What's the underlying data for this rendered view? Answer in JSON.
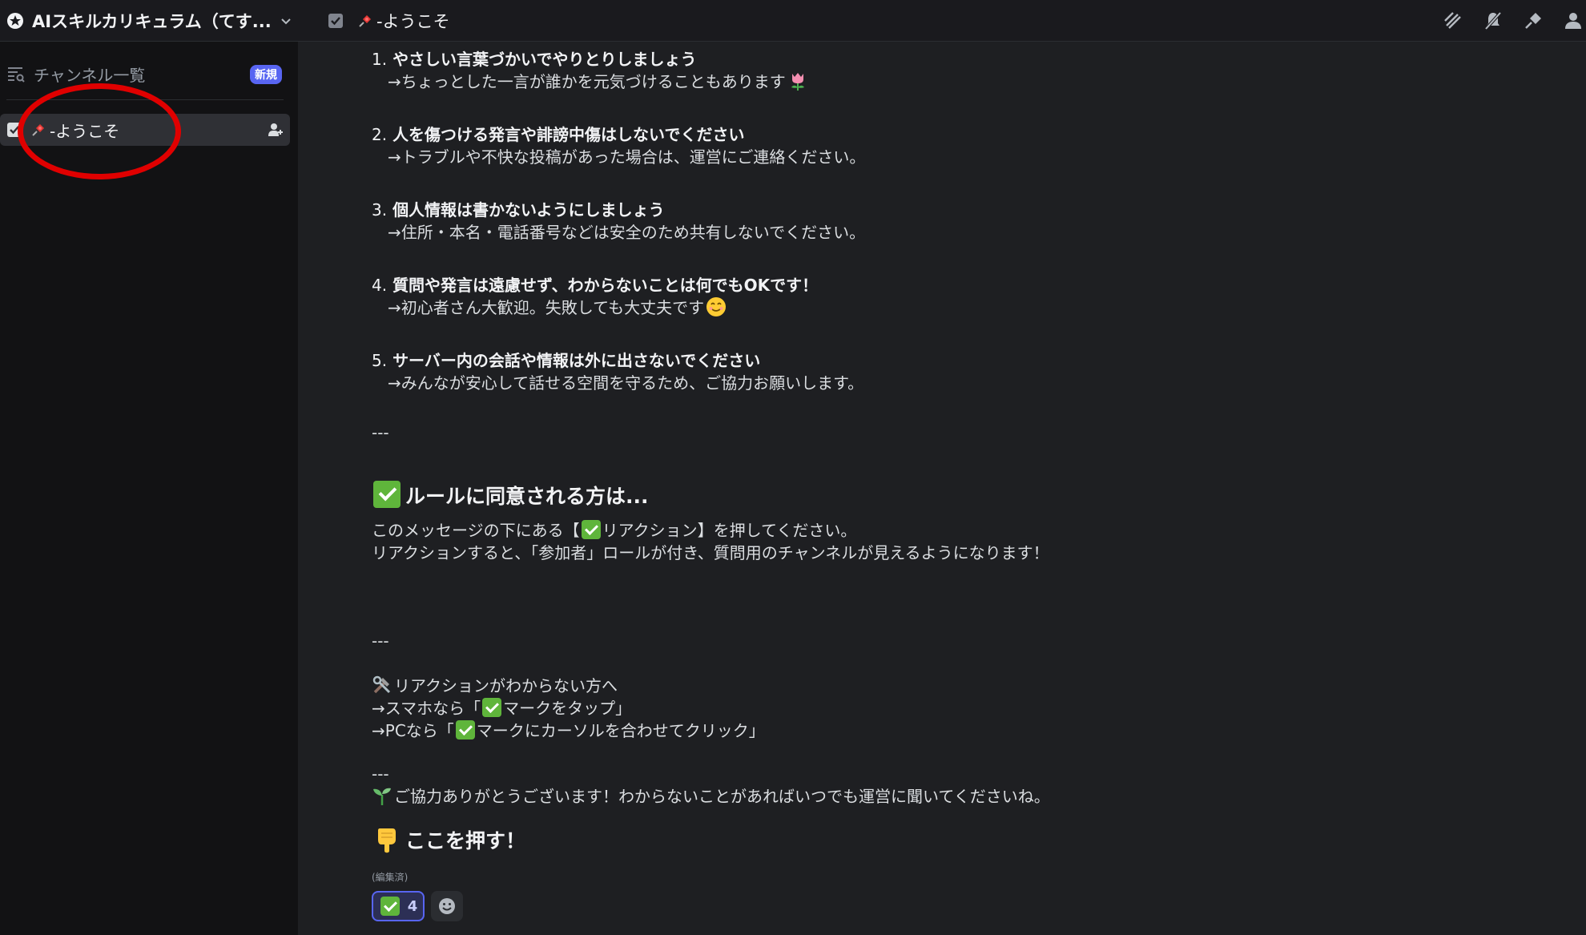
{
  "server": {
    "name": "AIスキルカリキュラム（てす..."
  },
  "channel": {
    "name": "-ようこそ"
  },
  "sidebar": {
    "browse_label": "チャンネル一覧",
    "new_badge": "新規",
    "channels": [
      {
        "label": "-ようこそ",
        "selected": true
      }
    ]
  },
  "toolbar": {
    "icons": [
      "threads-icon",
      "mute-icon",
      "pin-icon",
      "members-icon"
    ]
  },
  "message": {
    "rules": [
      {
        "num": "1.",
        "title": "やさしい言葉づかいでやりとりしましょう",
        "detail": "→ちょっとした一言が誰かを元気づけることもあります",
        "emoji": "tulip-emoji"
      },
      {
        "num": "2.",
        "title": "人を傷つける発言や誹謗中傷はしないでください",
        "detail": "→トラブルや不快な投稿があった場合は、運営にご連絡ください。"
      },
      {
        "num": "3.",
        "title": "個人情報は書かないようにしましょう",
        "detail": "→住所・本名・電話番号などは安全のため共有しないでください。"
      },
      {
        "num": "4.",
        "title": "質問や発言は遠慮せず、わからないことは何でもOKです！",
        "detail": "→初心者さん大歓迎。失敗しても大丈夫です",
        "emoji": "smile-emoji"
      },
      {
        "num": "5.",
        "title": "サーバー内の会話や情報は外に出さないでください",
        "detail": "→みんなが安心して話せる空間を守るため、ご協力お願いします。"
      }
    ],
    "separator": "---",
    "agree_heading": "ルールに同意される方は...",
    "agree_line1_before": "このメッセージの下にある【",
    "agree_line1_after": "リアクション】を押してください。",
    "agree_line2": "リアクションすると、「参加者」ロールが付き、質問用のチャンネルが見えるようになります！",
    "help_title": "リアクションがわからない方へ",
    "help_phone_before": "→スマホなら「",
    "help_phone_after": "マークをタップ」",
    "help_pc_before": "→PCなら「",
    "help_pc_after": "マークにカーソルを合わせてクリック」",
    "thanks": "ご協力ありがとうございます！わからないことがあればいつでも運営に聞いてくださいね。",
    "press_here": "ここを押す！",
    "edited": "(編集済)",
    "reaction_count": "4"
  },
  "colors": {
    "accent": "#5865f2",
    "check_green": "#5fb53b",
    "annotation": "#e00000"
  }
}
